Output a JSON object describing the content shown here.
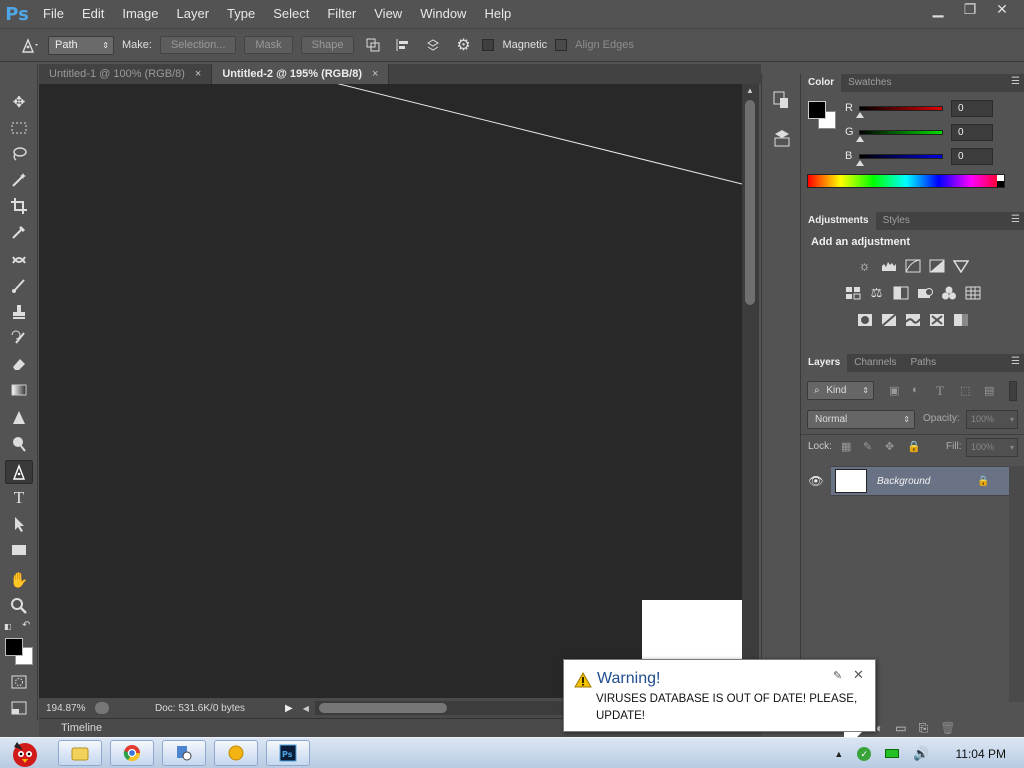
{
  "app": {
    "logo": "Ps",
    "accent": "#4fa6e4"
  },
  "menu": [
    "File",
    "Edit",
    "Image",
    "Layer",
    "Type",
    "Select",
    "Filter",
    "View",
    "Window",
    "Help"
  ],
  "options": {
    "mode": "Path",
    "make_label": "Make:",
    "selection_btn": "Selection...",
    "mask_btn": "Mask",
    "shape_btn": "Shape",
    "magnetic": "Magnetic",
    "align_edges": "Align Edges"
  },
  "tabs": [
    {
      "title": "Untitled-1 @ 100% (RGB/8)",
      "close": "×"
    },
    {
      "title": "Untitled-2 @ 195% (RGB/8)",
      "close": "×"
    }
  ],
  "status": {
    "zoom": "194.87%",
    "doc": "Doc: 531.6K/0 bytes"
  },
  "timeline": "Timeline",
  "color_panel": {
    "tabs": [
      "Color",
      "Swatches"
    ],
    "channels": [
      {
        "letter": "R",
        "value": "0"
      },
      {
        "letter": "G",
        "value": "0"
      },
      {
        "letter": "B",
        "value": "0"
      }
    ]
  },
  "adjustments": {
    "tabs": [
      "Adjustments",
      "Styles"
    ],
    "title": "Add an adjustment"
  },
  "layers": {
    "tabs": [
      "Layers",
      "Channels",
      "Paths"
    ],
    "filter": "Kind",
    "blend": "Normal",
    "opacity_label": "Opacity:",
    "opacity_value": "100%",
    "lock_label": "Lock:",
    "fill_label": "Fill:",
    "fill_value": "100%",
    "items": [
      {
        "name": "Background"
      }
    ]
  },
  "warning": {
    "title": "Warning!",
    "message": "VIRUSES DATABASE IS OUT OF DATE! PLEASE, UPDATE!"
  },
  "taskbar": {
    "time": "11:04 PM"
  }
}
